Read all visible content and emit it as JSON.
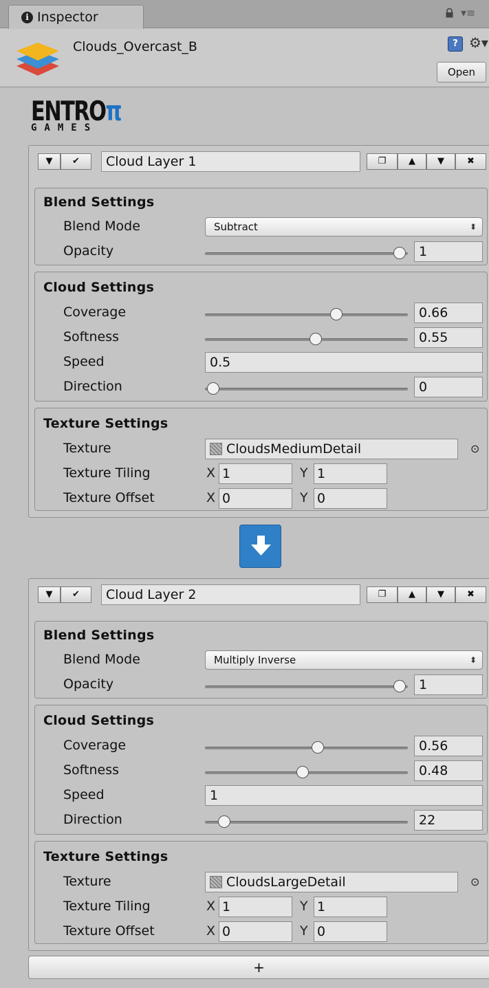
{
  "tab": {
    "label": "Inspector",
    "info_icon": "info-icon",
    "lock_icon": "lock-icon",
    "menu_icon": "tab-menu-icon"
  },
  "asset": {
    "name": "Clouds_Overcast_B",
    "open_label": "Open",
    "icon": "cloud-layers-icon"
  },
  "logo": {
    "word": "ENTRO",
    "pi": "π",
    "sub": "GAMES"
  },
  "layers": [
    {
      "name": "Cloud Layer 1",
      "blend": {
        "title": "Blend Settings",
        "mode_label": "Blend Mode",
        "mode_value": "Subtract",
        "opacity_label": "Opacity",
        "opacity_value": "1",
        "opacity_fraction": 1.0
      },
      "cloud": {
        "title": "Cloud Settings",
        "coverage_label": "Coverage",
        "coverage_value": "0.66",
        "coverage_fraction": 0.66,
        "softness_label": "Softness",
        "softness_value": "0.55",
        "softness_fraction": 0.55,
        "speed_label": "Speed",
        "speed_value": "0.5",
        "direction_label": "Direction",
        "direction_value": "0",
        "direction_fraction": 0.0
      },
      "texture": {
        "title": "Texture Settings",
        "texture_label": "Texture",
        "texture_value": "CloudsMediumDetail",
        "tiling_label": "Texture Tiling",
        "tiling_x": "1",
        "tiling_y": "1",
        "offset_label": "Texture Offset",
        "offset_x": "0",
        "offset_y": "0"
      }
    },
    {
      "name": "Cloud Layer 2",
      "blend": {
        "title": "Blend Settings",
        "mode_label": "Blend Mode",
        "mode_value": "Multiply Inverse",
        "opacity_label": "Opacity",
        "opacity_value": "1",
        "opacity_fraction": 1.0
      },
      "cloud": {
        "title": "Cloud Settings",
        "coverage_label": "Coverage",
        "coverage_value": "0.56",
        "coverage_fraction": 0.56,
        "softness_label": "Softness",
        "softness_value": "0.48",
        "softness_fraction": 0.48,
        "speed_label": "Speed",
        "speed_value": "1",
        "direction_label": "Direction",
        "direction_value": "22",
        "direction_fraction": 0.06
      },
      "texture": {
        "title": "Texture Settings",
        "texture_label": "Texture",
        "texture_value": "CloudsLargeDetail",
        "tiling_label": "Texture Tiling",
        "tiling_x": "1",
        "tiling_y": "1",
        "offset_label": "Texture Offset",
        "offset_x": "0",
        "offset_y": "0"
      }
    }
  ],
  "xy": {
    "x": "X",
    "y": "Y"
  },
  "layer_buttons": {
    "foldout": "▼",
    "enable": "✔",
    "duplicate": "❐",
    "move_up": "▲",
    "move_down": "▼",
    "remove": "✖"
  },
  "add_label": "+",
  "colors": {
    "accent": "#2f80c6",
    "panel": "#c2c2c2"
  }
}
